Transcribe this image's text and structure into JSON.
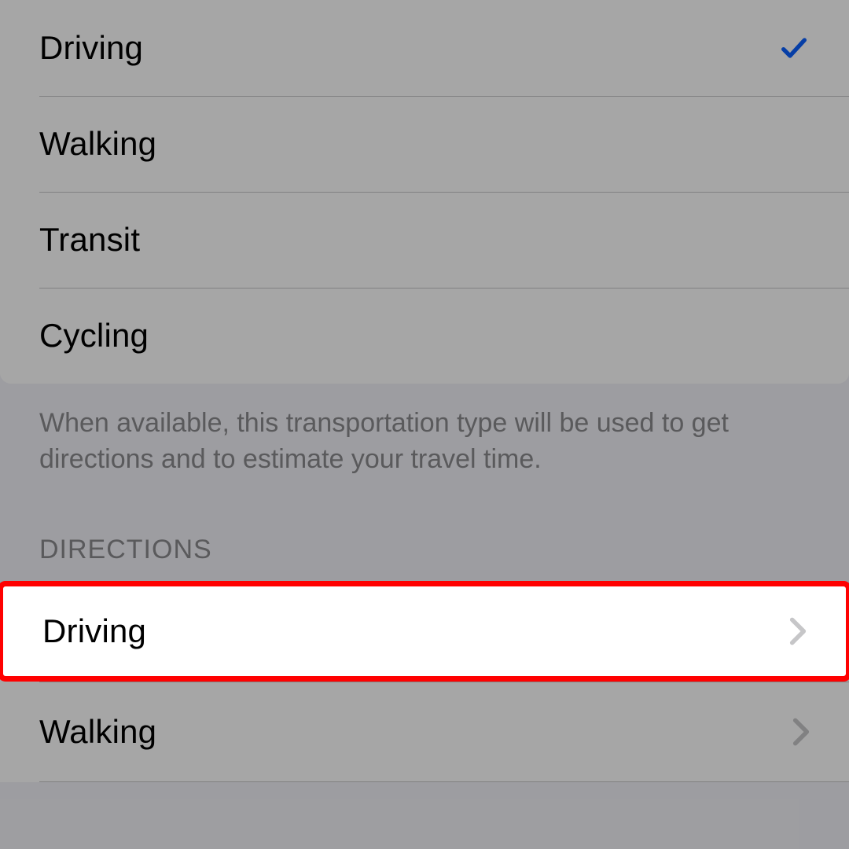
{
  "colors": {
    "accent": "#0a60ff",
    "chevron": "#c6c6c8",
    "highlight_border": "#ff0000"
  },
  "transport_section": {
    "options": [
      {
        "label": "Driving",
        "selected": true
      },
      {
        "label": "Walking",
        "selected": false
      },
      {
        "label": "Transit",
        "selected": false
      },
      {
        "label": "Cycling",
        "selected": false
      }
    ],
    "footer": "When available, this transportation type will be used to get directions and to estimate your travel time."
  },
  "directions_section": {
    "header": "DIRECTIONS",
    "items": [
      {
        "label": "Driving"
      },
      {
        "label": "Walking"
      }
    ]
  }
}
